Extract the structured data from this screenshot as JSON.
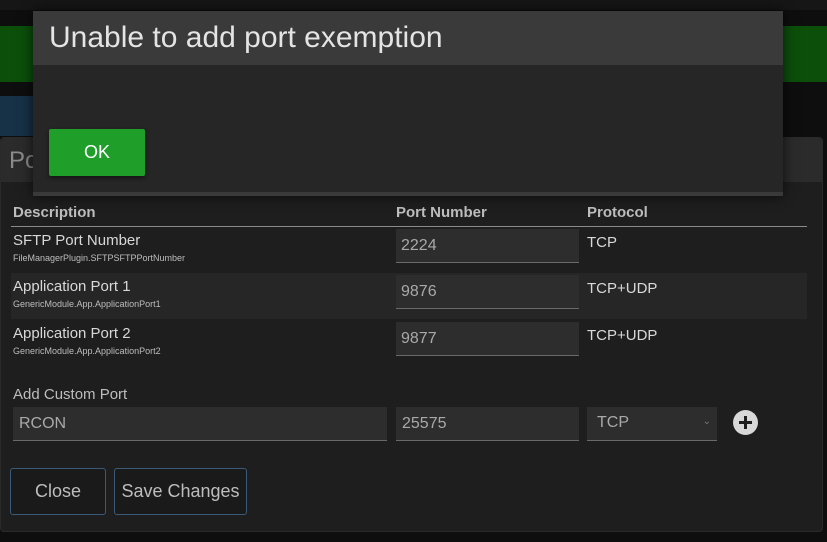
{
  "background_dialog": {
    "title": "Po",
    "columns": {
      "description": "Description",
      "port_number": "Port Number",
      "protocol": "Protocol"
    },
    "rows": [
      {
        "name": "SFTP Port Number",
        "key": "FileManagerPlugin.SFTPSFTPPortNumber",
        "port": "2224",
        "protocol": "TCP"
      },
      {
        "name": "Application Port 1",
        "key": "GenericModule.App.ApplicationPort1",
        "port": "9876",
        "protocol": "TCP+UDP"
      },
      {
        "name": "Application Port 2",
        "key": "GenericModule.App.ApplicationPort2",
        "port": "9877",
        "protocol": "TCP+UDP"
      }
    ],
    "add_custom": {
      "label": "Add Custom Port",
      "name_value": "RCON",
      "port_value": "25575",
      "protocol_selected": "TCP"
    },
    "buttons": {
      "close": "Close",
      "save": "Save Changes"
    }
  },
  "modal": {
    "title": "Unable to add port exemption",
    "ok_label": "OK"
  },
  "colors": {
    "ok_green": "#1f9e2a",
    "outline_blue": "#3a5a78",
    "header_green": "#0b4f0b"
  }
}
